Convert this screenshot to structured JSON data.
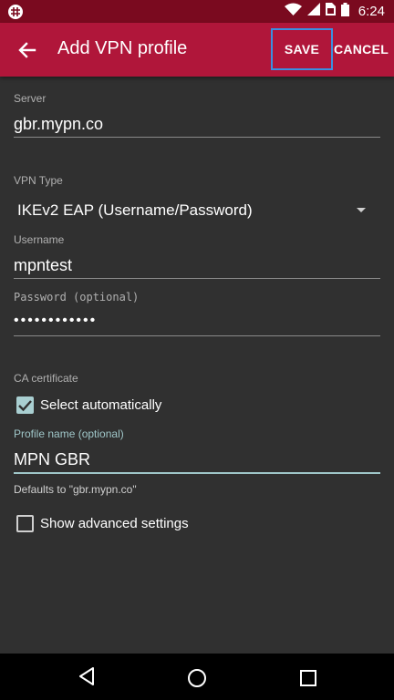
{
  "status_bar": {
    "time": "6:24",
    "icons": [
      "app-notification-icon",
      "wifi-icon",
      "cell-signal-icon",
      "sim-icon",
      "battery-icon"
    ]
  },
  "app_bar": {
    "title": "Add VPN profile",
    "save_label": "SAVE",
    "cancel_label": "CANCEL",
    "color": "#b0163a"
  },
  "form": {
    "server": {
      "label": "Server",
      "value": "gbr.mypn.co"
    },
    "vpn_type": {
      "label": "VPN Type",
      "value": "IKEv2 EAP (Username/Password)"
    },
    "username": {
      "label": "Username",
      "value": "mpntest"
    },
    "password": {
      "label": "Password (optional)",
      "value": "••••••••••••"
    },
    "ca_certificate": {
      "label": "CA certificate"
    },
    "select_automatically": {
      "label": "Select automatically",
      "checked": true
    },
    "profile_name": {
      "label": "Profile name (optional)",
      "value": "MPN GBR",
      "helper": "Defaults to \"gbr.mypn.co\""
    },
    "show_advanced": {
      "label": "Show advanced settings",
      "checked": false
    }
  },
  "nav_bar": {
    "icons": [
      "back-triangle-icon",
      "home-circle-icon",
      "recents-square-icon"
    ]
  },
  "colors": {
    "accent": "#9fc6c8",
    "status_bar": "#7a0a1f",
    "background": "#303030"
  }
}
